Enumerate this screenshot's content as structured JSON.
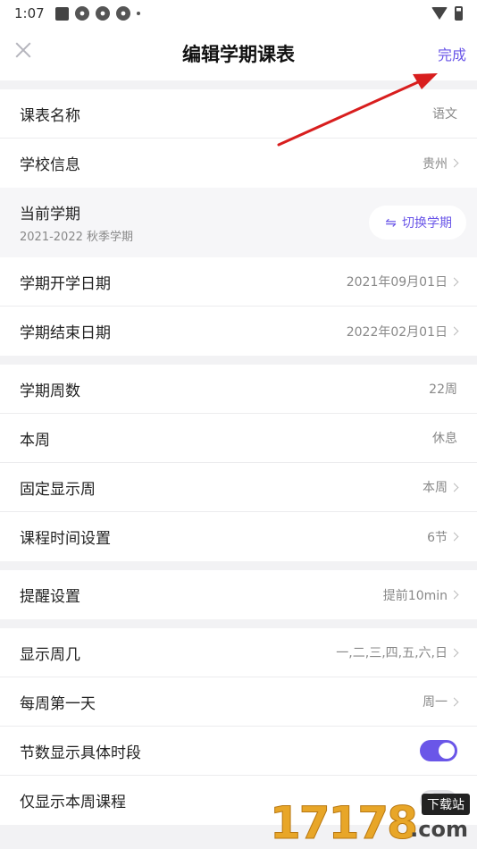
{
  "status_bar": {
    "time": "1:07"
  },
  "header": {
    "title": "编辑学期课表",
    "done": "完成"
  },
  "rows_group1": [
    {
      "label": "课表名称",
      "value": "语文",
      "chevron": false
    },
    {
      "label": "学校信息",
      "value": "贵州",
      "chevron": true
    }
  ],
  "term": {
    "label": "当前学期",
    "sub": "2021-2022 秋季学期",
    "button": "切换学期"
  },
  "rows_group2": [
    {
      "label": "学期开学日期",
      "value": "2021年09月01日"
    },
    {
      "label": "学期结束日期",
      "value": "2022年02月01日"
    }
  ],
  "rows_group3": [
    {
      "label": "学期周数",
      "value": "22周"
    },
    {
      "label": "本周",
      "value": "休息"
    },
    {
      "label": "固定显示周",
      "value": "本周"
    },
    {
      "label": "课程时间设置",
      "value": "6节"
    }
  ],
  "rows_group4": [
    {
      "label": "提醒设置",
      "value": "提前10min"
    }
  ],
  "rows_group5": [
    {
      "label": "显示周几",
      "value": "一,二,三,四,五,六,日"
    },
    {
      "label": "每周第一天",
      "value": "周一"
    },
    {
      "label": "节数显示具体时段",
      "toggle": true
    },
    {
      "label": "仅显示本周课程",
      "toggle": false
    }
  ],
  "colors": {
    "accent": "#6a56e8",
    "arrow": "#d81e1e"
  },
  "watermark": {
    "number": "17178",
    "tag": "下载站",
    "com": ".com"
  }
}
